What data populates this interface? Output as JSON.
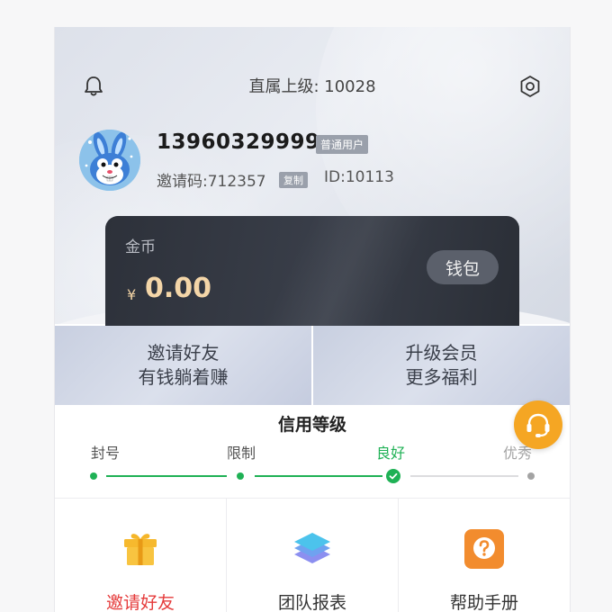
{
  "header": {
    "upline_text": "直属上级: 10028",
    "bell_icon": "bell-icon",
    "settings_icon": "settings-hex-icon"
  },
  "profile": {
    "avatar": "rabbit-avatar",
    "phone": "13960329999",
    "user_type": "普通用户",
    "invite_code": "邀请码:712357",
    "copy_label": "复制",
    "user_id": "ID:10113"
  },
  "coin_card": {
    "label": "金币",
    "currency_symbol": "¥",
    "balance": "0.00",
    "wallet_button": "钱包"
  },
  "promos": [
    {
      "line1": "邀请好友",
      "line2": "有钱躺着赚"
    },
    {
      "line1": "升级会员",
      "line2": "更多福利"
    }
  ],
  "credit": {
    "title": "信用等级",
    "levels": [
      {
        "label": "封号",
        "state": "done"
      },
      {
        "label": "限制",
        "state": "done"
      },
      {
        "label": "良好",
        "state": "current"
      },
      {
        "label": "优秀",
        "state": "pending"
      }
    ]
  },
  "support_icon": "customer-service-headset-icon",
  "menu": [
    {
      "label": "邀请好友",
      "icon": "gift-icon"
    },
    {
      "label": "团队报表",
      "icon": "layers-icon"
    },
    {
      "label": "帮助手册",
      "icon": "help-question-icon"
    }
  ],
  "colors": {
    "accent_green": "#1fb155",
    "gold": "#f4d6a8",
    "card_dark": "#2d313a",
    "support_orange": "#f5a623",
    "invite_red": "#e53b3b"
  }
}
